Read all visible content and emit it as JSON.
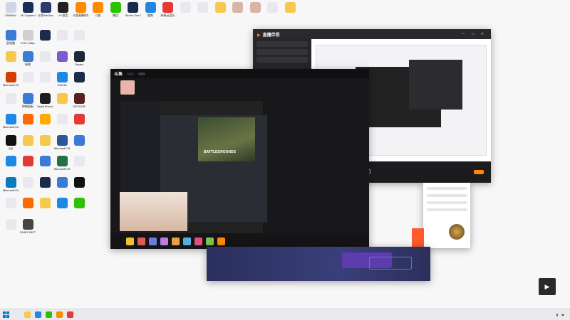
{
  "desktop_icons": [
    {
      "label": "3355444",
      "icon": "app-icon",
      "color": "#cfd6e6"
    },
    {
      "label": "4K Capture Utility",
      "icon": "capture-icon",
      "color": "#1b2e5a"
    },
    {
      "label": "斗鱼WeGame",
      "icon": "game-icon",
      "color": "#2a3a6a"
    },
    {
      "label": "YY语音",
      "icon": "yy-icon",
      "color": "#222"
    },
    {
      "label": "斗鱼直播伴侣",
      "icon": "douyu-icon",
      "color": "#ff8a00"
    },
    {
      "label": "斗鱼",
      "icon": "douyu-icon",
      "color": "#ff8a00"
    },
    {
      "label": "微信",
      "icon": "wechat-icon",
      "color": "#2dc100"
    },
    {
      "label": "Studio One 5",
      "icon": "studio-icon",
      "color": "#1c2b4a"
    },
    {
      "label": "酷狗",
      "icon": "kugou-icon",
      "color": "#1e88e5"
    },
    {
      "label": "网易云音乐",
      "icon": "netease-icon",
      "color": "#e53935"
    },
    {
      "label": "",
      "icon": "file-icon",
      "color": "#e8e8ee"
    },
    {
      "label": "",
      "icon": "file-icon",
      "color": "#e8e8ee"
    },
    {
      "label": "",
      "icon": "folder-icon",
      "color": "#f6c94c"
    },
    {
      "label": "",
      "icon": "photo-icon",
      "color": "#d9b3a6"
    },
    {
      "label": "",
      "icon": "photo-icon",
      "color": "#d9b3a6"
    },
    {
      "label": "",
      "icon": "file-icon",
      "color": "#e8e8ee"
    },
    {
      "label": "",
      "icon": "folder-icon",
      "color": "#f6c94c"
    },
    {
      "label": "此电脑",
      "icon": "computer-icon",
      "color": "#3a7bd5"
    },
    {
      "label": "EOS Utility",
      "icon": "eos-icon",
      "color": "#cfcfcf"
    },
    {
      "label": "",
      "icon": "app-icon",
      "color": "#1c2b4a"
    },
    {
      "label": "",
      "icon": "app-icon",
      "color": "#e8e8ee"
    },
    {
      "label": "",
      "icon": "app-icon",
      "color": "#e8e8ee"
    },
    {
      "label": "",
      "icon": "app-icon",
      "color": "#f6c94c"
    },
    {
      "label": "网络",
      "icon": "network-icon",
      "color": "#3a7bd5"
    },
    {
      "label": "",
      "icon": "app-icon",
      "color": "#e8e8ee"
    },
    {
      "label": "",
      "icon": "app-icon",
      "color": "#7a5bd1"
    },
    {
      "label": "Steam",
      "icon": "steam-icon",
      "color": "#1b2838"
    },
    {
      "label": "Microsoft Office",
      "icon": "office-icon",
      "color": "#d83b01"
    },
    {
      "label": "",
      "icon": "app-icon",
      "color": "#e8e8ee"
    },
    {
      "label": "",
      "icon": "app-icon",
      "color": "#e8e8ee"
    },
    {
      "label": "ToDesk",
      "icon": "todesk-icon",
      "color": "#1e88e5"
    },
    {
      "label": "",
      "icon": "app-icon",
      "color": "#1c2b4a"
    },
    {
      "label": "",
      "icon": "app-icon",
      "color": "#e8e8ee"
    },
    {
      "label": "控制面板",
      "icon": "control-panel-icon",
      "color": "#3a7bd5"
    },
    {
      "label": "Xsplit Broadcaster",
      "icon": "xsplit-icon",
      "color": "#1c1c1c"
    },
    {
      "label": "",
      "icon": "folder-icon",
      "color": "#f6c94c"
    },
    {
      "label": "DEVOUR",
      "icon": "game-icon",
      "color": "#5a2020"
    },
    {
      "label": "Microsoft Edge",
      "icon": "edge-icon",
      "color": "#1e88e5"
    },
    {
      "label": "",
      "icon": "app-icon",
      "color": "#ff6a00"
    },
    {
      "label": "",
      "icon": "app-icon",
      "color": "#ffaa00"
    },
    {
      "label": "",
      "icon": "app-icon",
      "color": "#e8e8ee"
    },
    {
      "label": "",
      "icon": "app-icon",
      "color": "#e53935"
    },
    {
      "label": "QQ",
      "icon": "qq-icon",
      "color": "#111"
    },
    {
      "label": "",
      "icon": "folder-icon",
      "color": "#f6c94c"
    },
    {
      "label": "",
      "icon": "folder-icon",
      "color": "#f6c94c"
    },
    {
      "label": "Microsoft Office",
      "icon": "office-icon",
      "color": "#2b579a"
    },
    {
      "label": "",
      "icon": "app-icon",
      "color": "#3a7bd5"
    },
    {
      "label": "",
      "icon": "app-icon",
      "color": "#1e88e5"
    },
    {
      "label": "",
      "icon": "app-icon",
      "color": "#e53935"
    },
    {
      "label": "",
      "icon": "app-icon",
      "color": "#3a7bd5"
    },
    {
      "label": "Microsoft Office",
      "icon": "office-icon",
      "color": "#217346"
    },
    {
      "label": "",
      "icon": "app-icon",
      "color": "#e8e8ee"
    },
    {
      "label": "Microsoft Edge",
      "icon": "edge-icon",
      "color": "#0a7bbd"
    },
    {
      "label": "",
      "icon": "app-icon",
      "color": "#e8e8ee"
    },
    {
      "label": "",
      "icon": "app-icon",
      "color": "#1c2b4a"
    },
    {
      "label": "",
      "icon": "app-icon",
      "color": "#3a7bd5"
    },
    {
      "label": "",
      "icon": "app-icon",
      "color": "#111"
    },
    {
      "label": "",
      "icon": "app-icon",
      "color": "#e8e8ee"
    },
    {
      "label": "",
      "icon": "app-icon",
      "color": "#ff6a00"
    },
    {
      "label": "",
      "icon": "app-icon",
      "color": "#f6c94c"
    },
    {
      "label": "",
      "icon": "app-icon",
      "color": "#1e88e5"
    },
    {
      "label": "",
      "icon": "app-icon",
      "color": "#2dc100"
    },
    {
      "label": "",
      "icon": "app-icon",
      "color": "#e8e8ee"
    },
    {
      "label": "PUBG BATTLEGR...",
      "icon": "pubg-icon",
      "color": "#444"
    }
  ],
  "back_window": {
    "app_name": "直播伴侣",
    "window_controls": "— □ ✕",
    "bottom_buttons": [
      {
        "label": "",
        "icon": "screen-icon"
      },
      {
        "label": "",
        "icon": "camera-icon"
      },
      {
        "label": "",
        "icon": "image-icon"
      },
      {
        "label": "",
        "icon": "window-icon"
      },
      {
        "label": "",
        "icon": "game-icon"
      },
      {
        "label": "",
        "icon": "mic-icon"
      },
      {
        "label": "",
        "icon": "speaker-icon"
      }
    ],
    "go_live_label": ""
  },
  "front_window": {
    "brand": "斗鱼",
    "tabs": [
      "",
      ""
    ],
    "stream_title": "",
    "game_name": "BATTLEGROUNDS"
  },
  "banner": {
    "button_label": ""
  },
  "taskbar": {
    "time": "",
    "date": ""
  },
  "colors": {
    "accent": "#ff8a00",
    "live_red": "#ff5a2b",
    "taskbar": "#e9e9ee"
  }
}
